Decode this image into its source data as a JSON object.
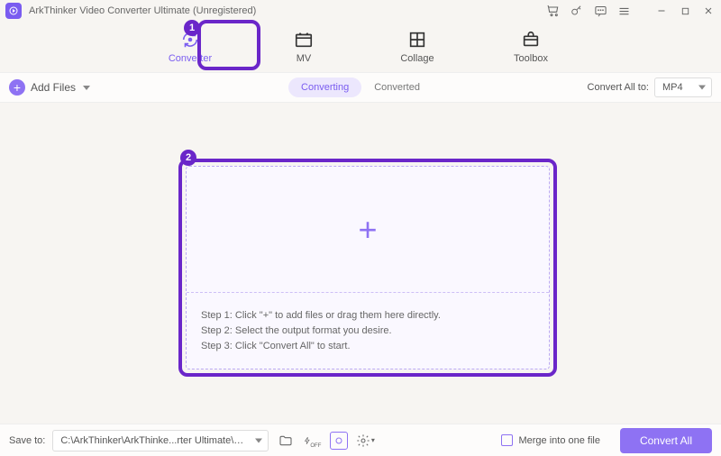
{
  "titlebar": {
    "app_title": "ArkThinker Video Converter Ultimate (Unregistered)"
  },
  "toptabs": {
    "converter": "Converter",
    "mv": "MV",
    "collage": "Collage",
    "toolbox": "Toolbox"
  },
  "subbar": {
    "add_files": "Add Files",
    "converting": "Converting",
    "converted": "Converted",
    "convert_all_to": "Convert All to:",
    "format": "MP4"
  },
  "dropzone": {
    "step1": "Step 1: Click \"+\" to add files or drag them here directly.",
    "step2": "Step 2: Select the output format you desire.",
    "step3": "Step 3: Click \"Convert All\" to start."
  },
  "annotations": {
    "badge1": "1",
    "badge2": "2"
  },
  "bottombar": {
    "save_to": "Save to:",
    "path": "C:\\ArkThinker\\ArkThinke...rter Ultimate\\Converted",
    "merge": "Merge into one file",
    "convert_all": "Convert All"
  }
}
